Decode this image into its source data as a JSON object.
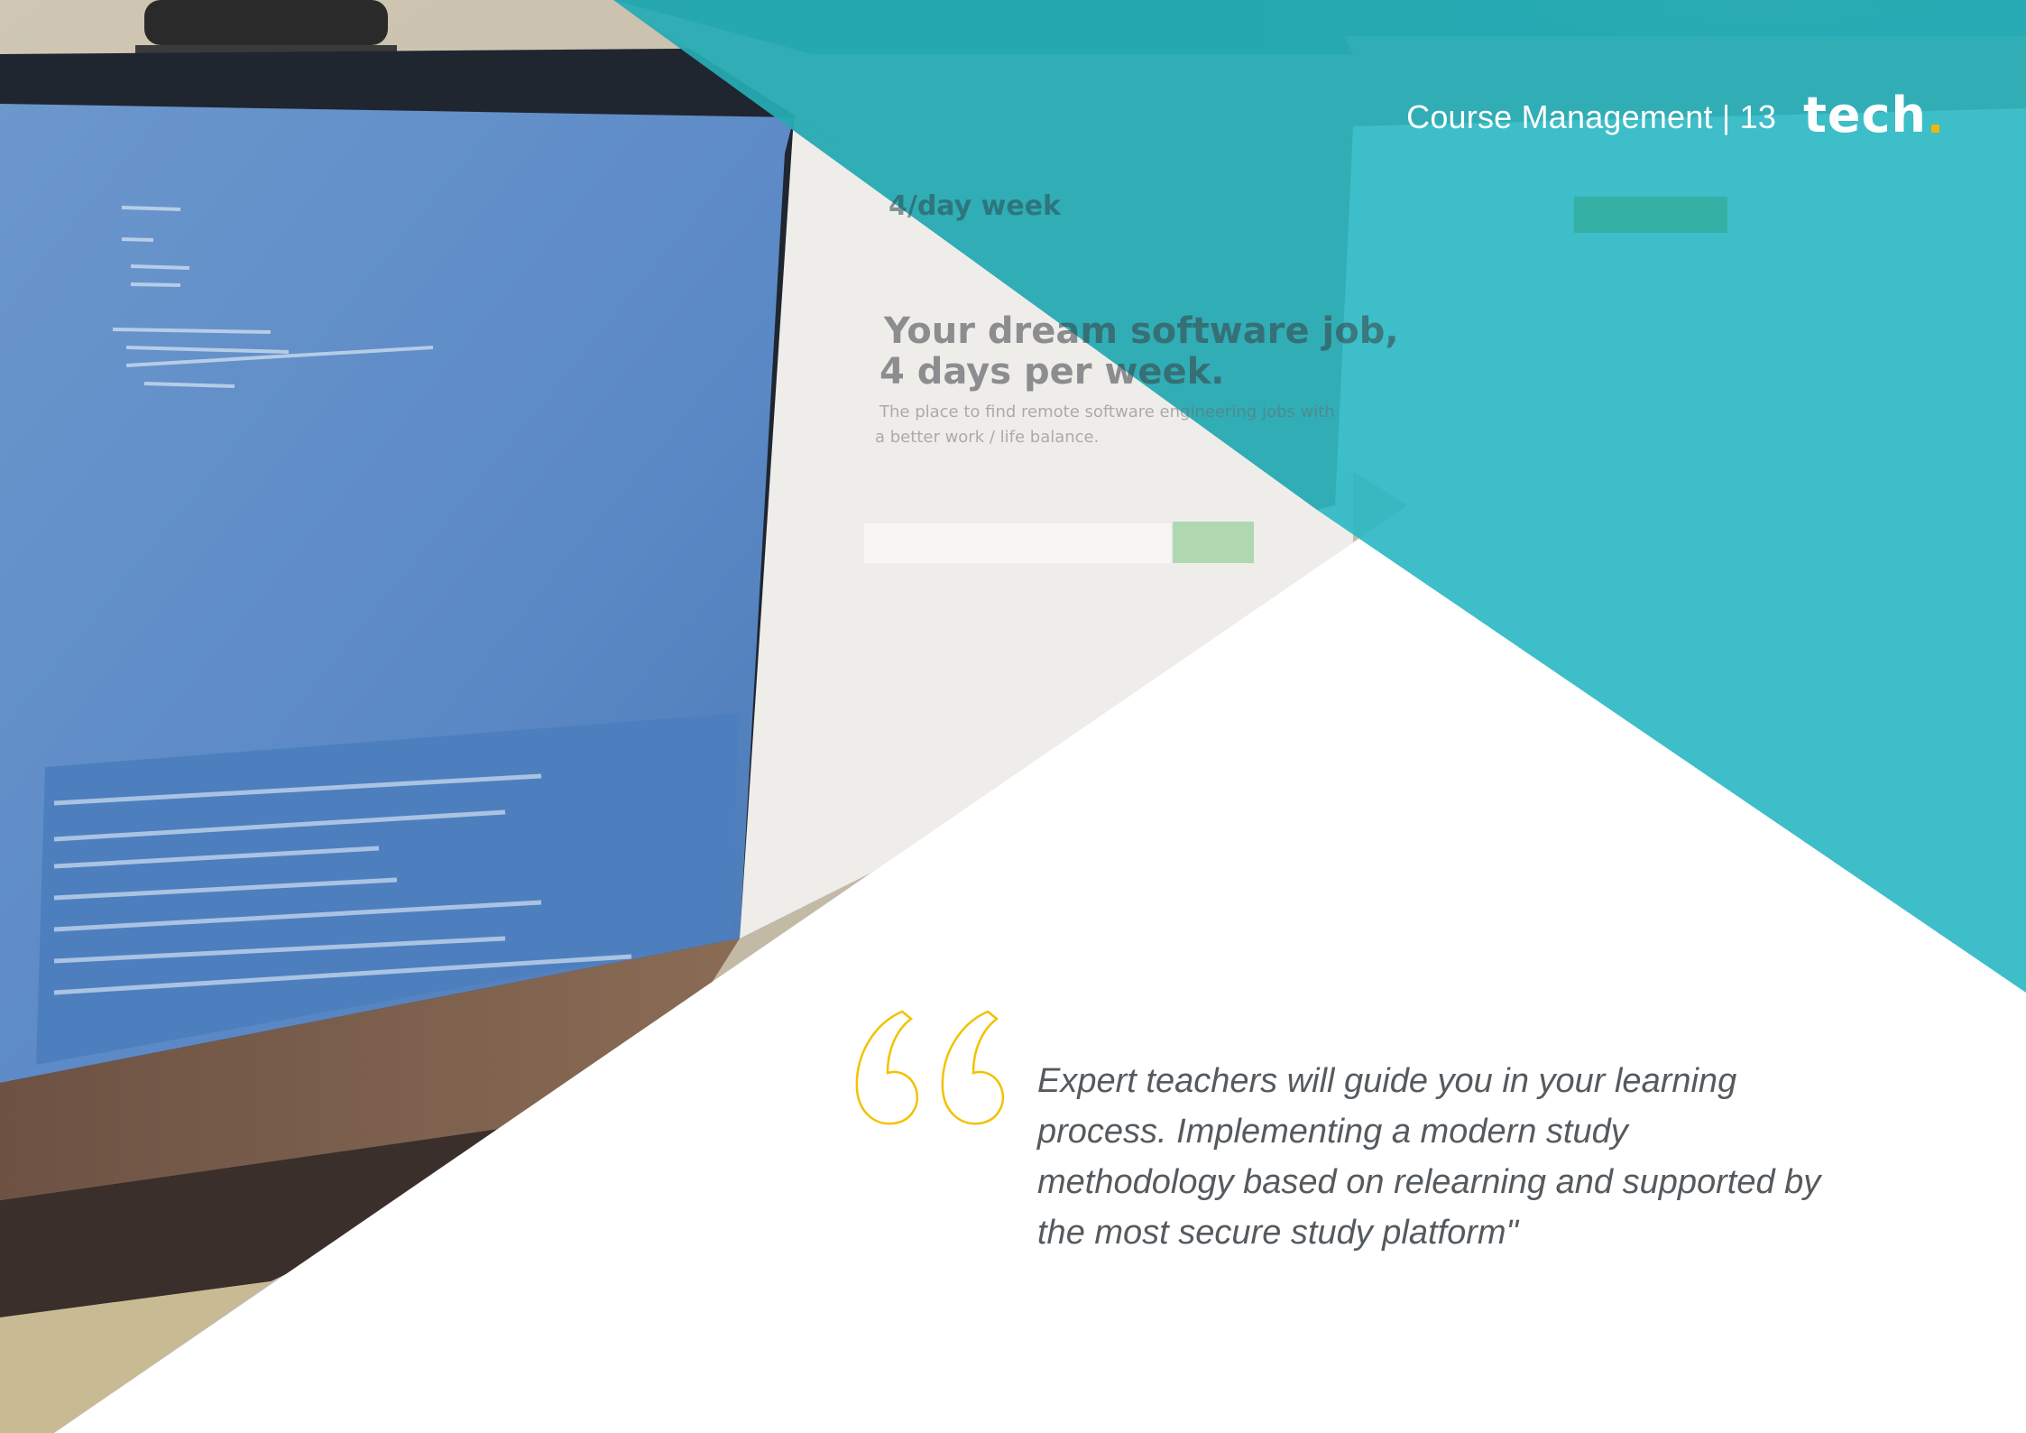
{
  "header": {
    "text": "Course Management | 13",
    "logo": "tech"
  },
  "quote": {
    "icon": "quotation-mark-icon",
    "text": "Expert teachers will guide you in your learning process. Implementing a modern study methodology based on relearning and supported by the most secure study platform\""
  },
  "photo": {
    "site_logo": "4/day week",
    "headline_line1": "Your dream software job,",
    "headline_line2": "4 days per week.",
    "subtitle_line1": "The place to find remote software engineering jobs with",
    "subtitle_line2": "a better work / life balance."
  },
  "colors": {
    "teal": "#2cb9c3",
    "dark_teal": "#1a8a8a",
    "quote_yellow": "#f2c200",
    "logo_dot": "#f0b800"
  }
}
